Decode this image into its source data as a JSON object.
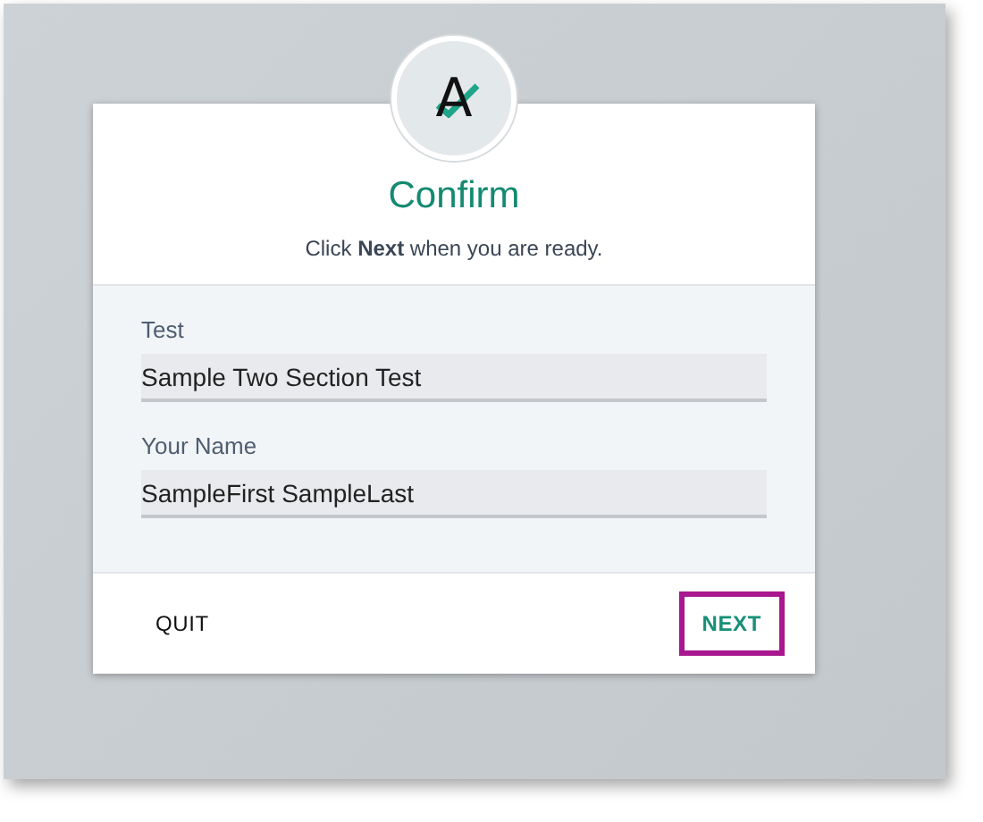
{
  "logo": {
    "letter": "A"
  },
  "title": "Confirm",
  "instruction": "Click **Next** when you are ready.",
  "fields": [
    {
      "label": "Test",
      "value": "Sample Two Section Test"
    },
    {
      "label": "Your Name",
      "value": "SampleFirst SampleLast"
    }
  ],
  "buttons": [
    {
      "label": "QUIT",
      "kind": "secondary",
      "highlighted": false
    },
    {
      "label": "NEXT",
      "kind": "primary",
      "highlighted": true
    }
  ]
}
